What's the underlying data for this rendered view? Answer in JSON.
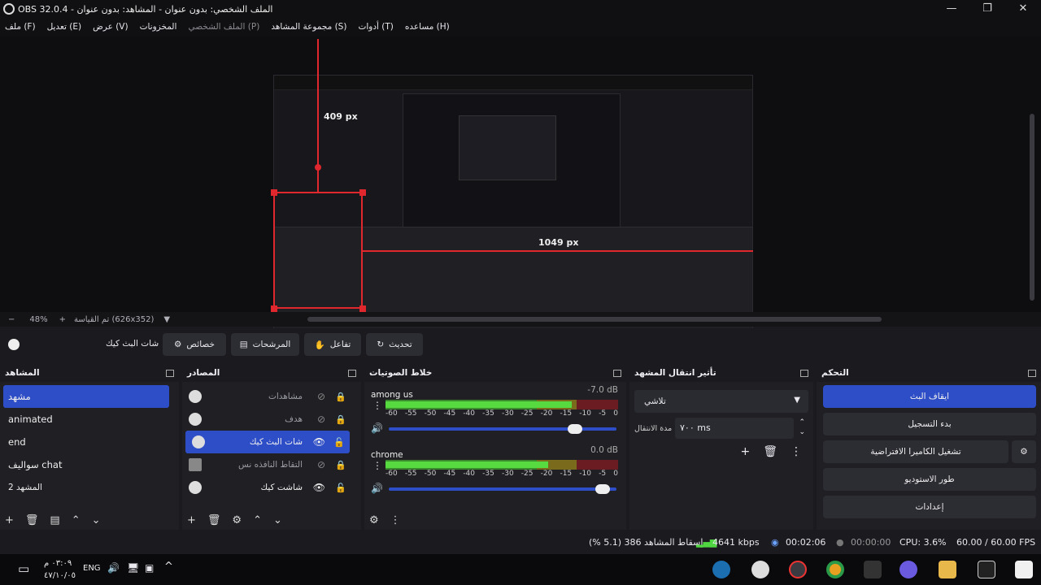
{
  "window": {
    "title": "OBS 32.0.4 - الملف الشخصي: بدون عنوان - المشاهد: بدون عنوان",
    "controls": [
      "—",
      "❐",
      "✕"
    ]
  },
  "menu": [
    {
      "label": "ملف (F)",
      "dim": false
    },
    {
      "label": "تعديل (E)",
      "dim": false
    },
    {
      "label": "عرض (V)",
      "dim": false
    },
    {
      "label": "المخزونات",
      "dim": false
    },
    {
      "label": "الملف الشخصي (P)",
      "dim": true
    },
    {
      "label": "مجموعة المشاهد (S)",
      "dim": false
    },
    {
      "label": "أدوات (T)",
      "dim": false
    },
    {
      "label": "مساعده (H)",
      "dim": false
    }
  ],
  "preview": {
    "measure_vertical": "409 px",
    "measure_horizontal": "1049 px"
  },
  "zoom": {
    "minus": "−",
    "level": "48%",
    "plus": "+",
    "scale_label": "تم القياسة (626x352)",
    "dropdown": "▼"
  },
  "toolbar": {
    "current_source": "شات البث كيك",
    "properties": "خصائص",
    "filters": "المرشحات",
    "interact": "تفاعل",
    "refresh": "تحديث"
  },
  "scenes": {
    "title": "المشاهد",
    "items": [
      "مشهد",
      "animated",
      "end",
      "سواليف chat",
      "المشهد 2"
    ],
    "selected_index": 0
  },
  "sources": {
    "title": "المصادر",
    "items": [
      {
        "name": "مشاهدات",
        "visible": false,
        "locked": true,
        "dim": true
      },
      {
        "name": "هدف",
        "visible": false,
        "locked": true,
        "dim": true
      },
      {
        "name": "شات البث كيك",
        "visible": true,
        "locked": false,
        "dim": false
      },
      {
        "name": "التقاط النافذه نس",
        "visible": false,
        "locked": true,
        "dim": true
      },
      {
        "name": "شاشت كيك",
        "visible": true,
        "locked": false,
        "dim": false
      }
    ],
    "selected_index": 2
  },
  "mixer": {
    "title": "خلاط الصوتيات",
    "channels": [
      {
        "name": "among us",
        "db": "-7.0 dB",
        "level": 0.8,
        "volume": 0.85
      },
      {
        "name": "chrome",
        "db": "0.0 dB",
        "level": 0.7,
        "volume": 0.97
      }
    ],
    "scale": [
      "-60",
      "-55",
      "-50",
      "-45",
      "-40",
      "-35",
      "-30",
      "-25",
      "-20",
      "-15",
      "-10",
      "-5",
      "0"
    ]
  },
  "transitions": {
    "title": "تأثير انتقال المشهد",
    "type": "تلاشي",
    "duration_label": "مدة الانتقال",
    "duration_value": "٧٠٠ ms"
  },
  "controls": {
    "title": "التحكم",
    "stop_stream": "ايقاف البث",
    "start_record": "بدء التسجيل",
    "virtual_cam": "تشغيل الكاميرا الافتراضية",
    "studio_mode": "طور الاستوديو",
    "settings": "إعدادات"
  },
  "status": {
    "dropped_frames": "إسقاط المشاهد 386 (5.1 %)",
    "bitrate": "4641 kbps",
    "stream_time": "00:02:06",
    "record_time": "00:00:00",
    "cpu": "CPU: 3.6%",
    "fps": "60.00 / 60.00 FPS"
  },
  "taskbar": {
    "time": "٠٣:٠٩ م",
    "date": "٤٧/١٠/٠٥",
    "lang": "ENG"
  },
  "colors": {
    "accent": "#2e4ec8",
    "measure_red": "#e0272e",
    "background": "#1b1b1f",
    "dock": "#1f1f24"
  }
}
